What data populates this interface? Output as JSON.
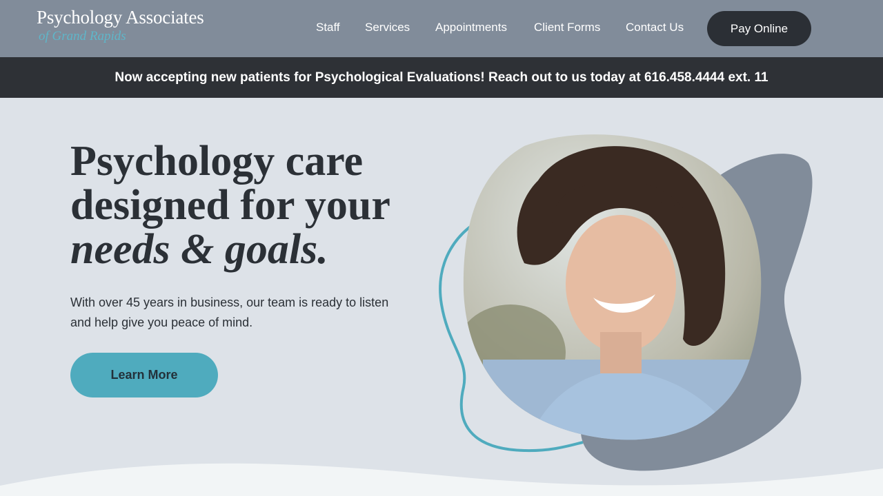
{
  "header": {
    "logo_main": "Psychology Associates",
    "logo_sub": "of Grand Rapids",
    "nav": [
      "Staff",
      "Services",
      "Appointments",
      "Client Forms",
      "Contact Us"
    ],
    "cta_label": "Pay Online"
  },
  "announcement": "Now accepting new patients for Psychological Evaluations! Reach out to us today at 616.458.4444 ext. 11",
  "hero": {
    "headline_line1": "Psychology care",
    "headline_line2": "designed for your",
    "headline_line3": "needs & goals.",
    "description": "With over 45 years in business, our team is ready to listen and help give you peace of mind.",
    "button_label": "Learn More"
  },
  "colors": {
    "header_bg": "#818c9a",
    "announcement_bg": "#2e3136",
    "hero_bg": "#dde2e8",
    "accent_teal": "#4fabbe",
    "blob_slate": "#818c9a",
    "text_dark": "#2b3036"
  }
}
